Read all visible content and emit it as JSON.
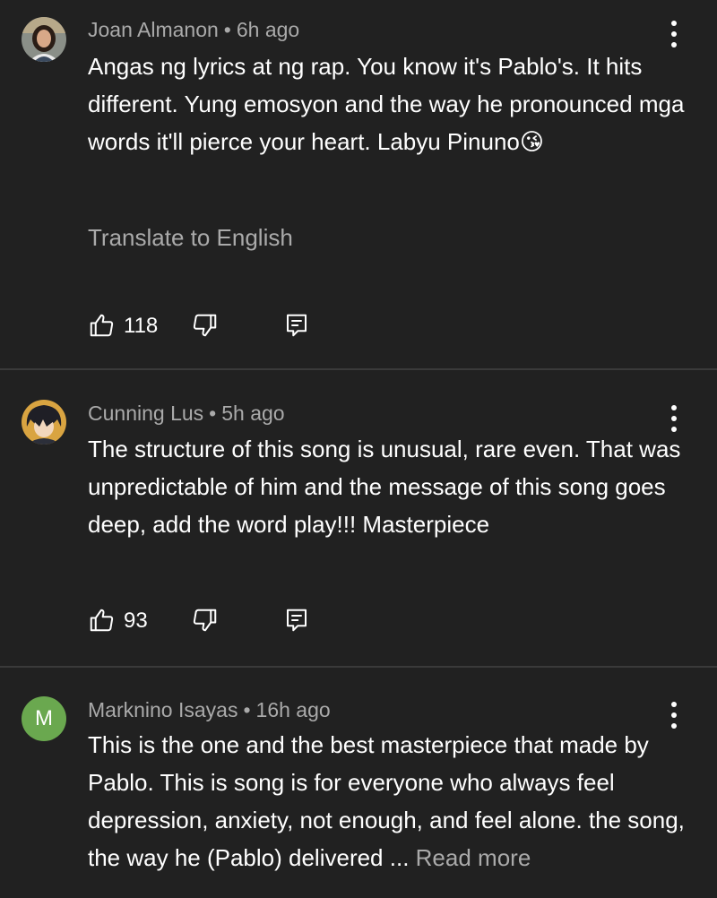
{
  "comments": [
    {
      "author": "Joan Almanon",
      "time": "6h ago",
      "text": "Angas ng lyrics at ng rap. You know it's Pablo's. It hits different. Yung emosyon and the way he pronounced mga words it'll pierce your heart. Labyu Pinuno",
      "emoji": "😘",
      "translate": "Translate to English",
      "likes": "118"
    },
    {
      "author": "Cunning Lus",
      "time": "5h ago",
      "text": "The structure of this song is unusual, rare even. That was unpredictable of him and the message of this song goes deep, add the word play!!! Masterpiece",
      "likes": "93"
    },
    {
      "author": "Marknino Isayas",
      "time": "16h ago",
      "avatar_letter": "M",
      "text": "This is the one and the best masterpiece that made by Pablo. This is song is for everyone who always feel depression, anxiety, not enough, and feel alone. the song, the way he (Pablo) delivered ...",
      "read_more": "Read more"
    }
  ],
  "separator": "•",
  "colors": {
    "background": "#212121",
    "secondary_text": "#aaaaaa",
    "avatar_green": "#6aa84f"
  },
  "icons": [
    "like-icon",
    "dislike-icon",
    "reply-icon",
    "more-options-icon"
  ]
}
